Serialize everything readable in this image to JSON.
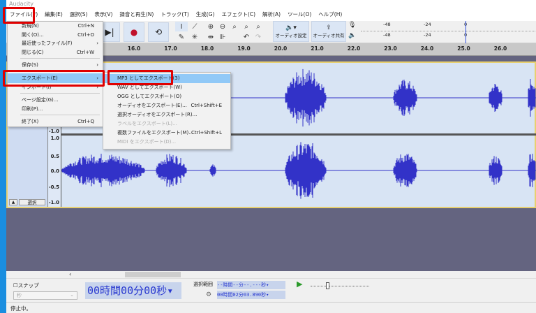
{
  "app": {
    "title": "Audacity"
  },
  "menubar": [
    "ファイル(F)",
    "編集(E)",
    "選択(S)",
    "表示(V)",
    "録音と再生(N)",
    "トラック(T)",
    "生成(G)",
    "エフェクト(C)",
    "解析(A)",
    "ツール(O)",
    "ヘルプ(H)"
  ],
  "toolbar": {
    "audio_setup": "オーディオ設定",
    "audio_share": "オーディオ共有",
    "meter_labels": [
      "-48",
      "-24",
      "0"
    ]
  },
  "ruler": {
    "ticks": [
      "16.0",
      "17.0",
      "18.0",
      "19.0",
      "20.0",
      "21.0",
      "22.0",
      "23.0",
      "24.0",
      "25.0",
      "26.0"
    ]
  },
  "track": {
    "select_label": "選択",
    "scale": [
      "-1.0",
      "1.0",
      "0.5",
      "0.0",
      "-0.5",
      "-1.0"
    ]
  },
  "file_menu": {
    "items": [
      {
        "label": "新規(N)",
        "shortcut": "Ctrl+N"
      },
      {
        "label": "開く(O)...",
        "shortcut": "Ctrl+O"
      },
      {
        "label": "最近使ったファイル(F)",
        "arrow": "›"
      },
      {
        "label": "閉じる(C)",
        "shortcut": "Ctrl+W"
      },
      {
        "label": "保存(S)",
        "arrow": "›"
      },
      {
        "label": "エクスポート(E)",
        "arrow": "›"
      },
      {
        "label": "インポート(I)",
        "arrow": "›"
      },
      {
        "label": "ページ設定(G)..."
      },
      {
        "label": "印刷(P)..."
      },
      {
        "label": "終了(X)",
        "shortcut": "Ctrl+Q"
      }
    ]
  },
  "export_menu": {
    "items": [
      {
        "label": "MP3 としてエクスポート(3)"
      },
      {
        "label": "WAV としてエクスポート(W)"
      },
      {
        "label": "OGG としてエクスポート(O)"
      },
      {
        "label": "オーディオをエクスポート(E)...",
        "shortcut": "Ctrl+Shift+E"
      },
      {
        "label": "選択オーディオをエクスポート(R)..."
      },
      {
        "label": "ラベルをエクスポート(L)..."
      },
      {
        "label": "複数ファイルをエクスポート(M)...",
        "shortcut": "Ctrl+Shift+L"
      },
      {
        "label": "MIDI をエクスポート(D)..."
      }
    ]
  },
  "bottom": {
    "snap_label": "スナップ",
    "snap_unit": "秒",
    "time_display": "00時間00分00秒",
    "selection_label": "選択範囲",
    "sel_start": "--時間--分--.---秒",
    "sel_end": "00時間02分03.890秒"
  },
  "status": "停止中。",
  "colors": {
    "wave": "#3232c8",
    "highlight": "#e00000",
    "menu_hl": "#91c9f7"
  }
}
